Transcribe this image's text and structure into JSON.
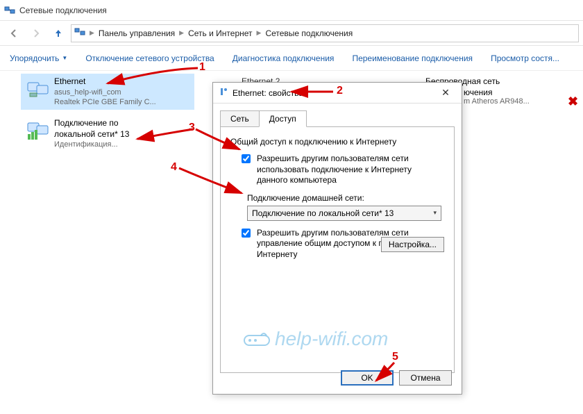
{
  "window": {
    "title": "Сетевые подключения"
  },
  "breadcrumb": {
    "root": "Панель управления",
    "mid": "Сеть и Интернет",
    "leaf": "Сетевые подключения"
  },
  "toolbar": {
    "organize": "Упорядочить",
    "disable": "Отключение сетевого устройства",
    "diagnose": "Диагностика подключения",
    "rename": "Переименование подключения",
    "view_state": "Просмотр состя..."
  },
  "connections": {
    "ethernet": {
      "name": "Ethernet",
      "sub1": "asus_help-wifi_com",
      "sub2": "Realtek PCIe GBE Family C..."
    },
    "ethernet2_partial": "Ethernet 2",
    "ethernet2_sub": "ючения",
    "ethernet2_sub2": "m Atheros AR948...",
    "wireless": {
      "name": "Беспроводная сеть"
    },
    "lan": {
      "name": "Подключение по локальной сети* 13",
      "sub1": "Идентификация..."
    }
  },
  "dialog": {
    "title": "Ethernet: свойства",
    "tab_network": "Сеть",
    "tab_access": "Доступ",
    "group": "Общий доступ к подключению к Интернету",
    "chk1": "Разрешить другим пользователям сети использовать подключение к Интернету данного компьютера",
    "home_label": "Подключение домашней сети:",
    "home_value": "Подключение по локальной сети* 13",
    "chk2": "Разрешить другим пользователям сети управление общим доступом к подключению к Интернету",
    "configure": "Настройка...",
    "ok": "OK",
    "cancel": "Отмена"
  },
  "annotations": {
    "n1": "1",
    "n2": "2",
    "n3": "3",
    "n4": "4",
    "n5": "5"
  },
  "watermark": "help-wifi.com"
}
